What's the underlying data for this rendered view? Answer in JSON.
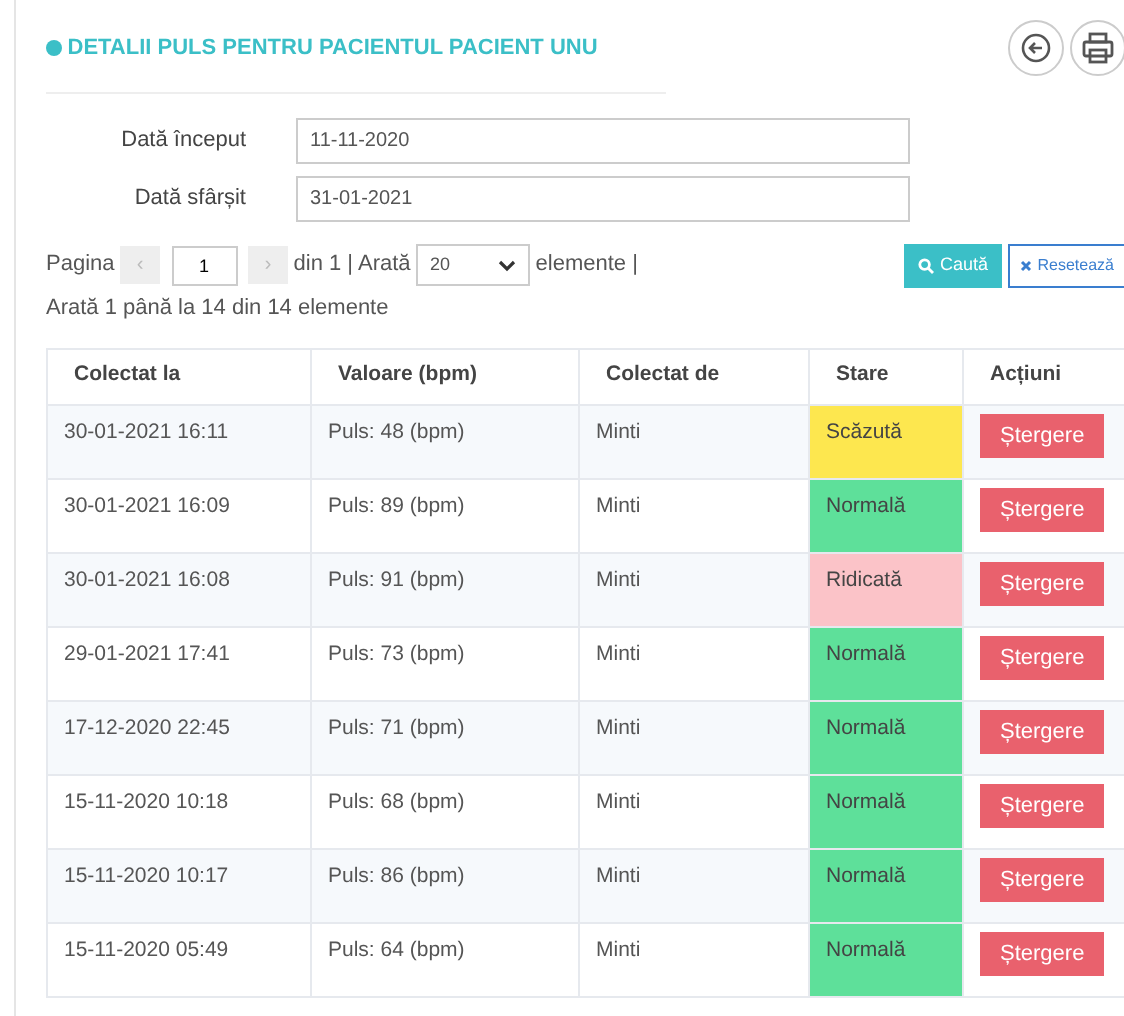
{
  "title": "DETALII PULS PENTRU PACIENTUL PACIENT UNU",
  "filters": [
    {
      "label": "Dată început",
      "value": "11-11-2020"
    },
    {
      "label": "Dată sfârșit",
      "value": "31-01-2021"
    }
  ],
  "pager": {
    "page_label": "Pagina",
    "prev": "‹",
    "page": "1",
    "next": "›",
    "of": "din 1 | Arată",
    "page_size": "20",
    "items_label": "elemente |",
    "summary": "Arată 1 până la 14 din 14 elemente"
  },
  "buttons": {
    "search": "Caută",
    "reset": "Resetează"
  },
  "table": {
    "columns": [
      "Colectat la",
      "Valoare (bpm)",
      "Colectat de",
      "Stare",
      "Acțiuni"
    ],
    "rows": [
      {
        "collected_at": "30-01-2021 16:11",
        "value": "Puls: 48 (bpm)",
        "collected_by": "Minti",
        "status": "Scăzută",
        "color": "#fde74f",
        "action": "Ștergere"
      },
      {
        "collected_at": "30-01-2021 16:09",
        "value": "Puls: 89 (bpm)",
        "collected_by": "Minti",
        "status": "Normală",
        "color": "#5ee09a",
        "action": "Ștergere"
      },
      {
        "collected_at": "30-01-2021 16:08",
        "value": "Puls: 91 (bpm)",
        "collected_by": "Minti",
        "status": "Ridicată",
        "color": "#fbc3c8",
        "action": "Ștergere"
      },
      {
        "collected_at": "29-01-2021 17:41",
        "value": "Puls: 73 (bpm)",
        "collected_by": "Minti",
        "status": "Normală",
        "color": "#5ee09a",
        "action": "Ștergere"
      },
      {
        "collected_at": "17-12-2020 22:45",
        "value": "Puls: 71 (bpm)",
        "collected_by": "Minti",
        "status": "Normală",
        "color": "#5ee09a",
        "action": "Ștergere"
      },
      {
        "collected_at": "15-11-2020 10:18",
        "value": "Puls: 68 (bpm)",
        "collected_by": "Minti",
        "status": "Normală",
        "color": "#5ee09a",
        "action": "Ștergere"
      },
      {
        "collected_at": "15-11-2020 10:17",
        "value": "Puls: 86 (bpm)",
        "collected_by": "Minti",
        "status": "Normală",
        "color": "#5ee09a",
        "action": "Ștergere"
      },
      {
        "collected_at": "15-11-2020 05:49",
        "value": "Puls: 64 (bpm)",
        "collected_by": "Minti",
        "status": "Normală",
        "color": "#5ee09a",
        "action": "Ștergere"
      }
    ]
  }
}
